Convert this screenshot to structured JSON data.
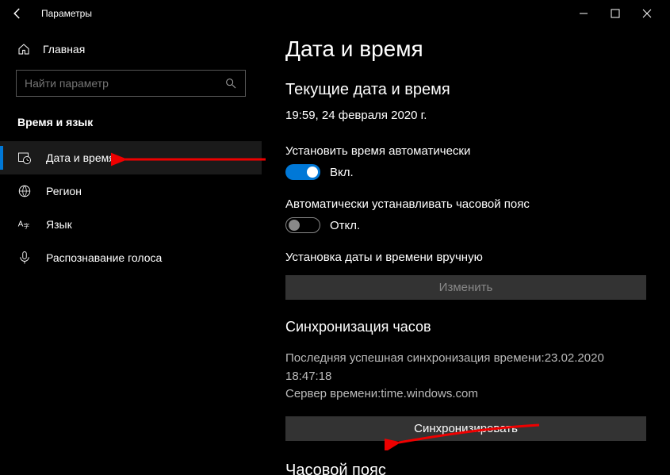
{
  "window": {
    "title": "Параметры"
  },
  "sidebar": {
    "home_label": "Главная",
    "search_placeholder": "Найти параметр",
    "group_label": "Время и язык",
    "items": [
      {
        "label": "Дата и время"
      },
      {
        "label": "Регион"
      },
      {
        "label": "Язык"
      },
      {
        "label": "Распознавание голоса"
      }
    ]
  },
  "content": {
    "page_title": "Дата и время",
    "current_section": "Текущие дата и время",
    "current_datetime": "19:59, 24 февраля 2020 г.",
    "auto_time_label": "Установить время автоматически",
    "auto_time_state": "Вкл.",
    "auto_tz_label": "Автоматически устанавливать часовой пояс",
    "auto_tz_state": "Откл.",
    "manual_set_label": "Установка даты и времени вручную",
    "change_button": "Изменить",
    "sync_section": "Синхронизация часов",
    "sync_info_line1": "Последняя успешная синхронизация времени:23.02.2020 18:47:18",
    "sync_info_line2": "Сервер времени:time.windows.com",
    "sync_button": "Синхронизировать",
    "tz_section": "Часовой пояс"
  }
}
